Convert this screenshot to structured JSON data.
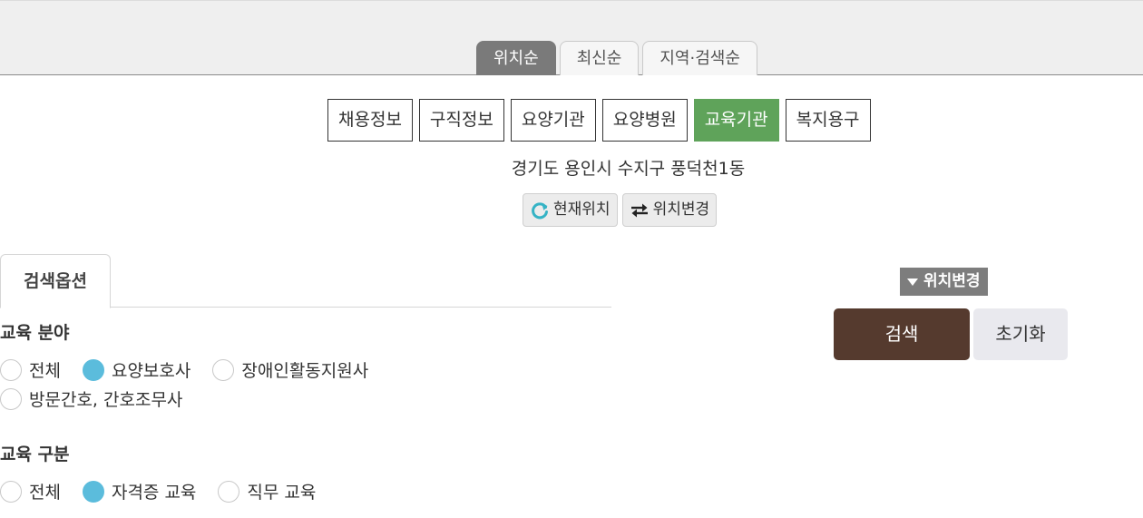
{
  "sort_tabs": [
    {
      "label": "위치순",
      "active": true
    },
    {
      "label": "최신순",
      "active": false
    },
    {
      "label": "지역·검색순",
      "active": false
    }
  ],
  "categories": [
    {
      "label": "채용정보",
      "active": false
    },
    {
      "label": "구직정보",
      "active": false
    },
    {
      "label": "요양기관",
      "active": false
    },
    {
      "label": "요양병원",
      "active": false
    },
    {
      "label": "교육기관",
      "active": true
    },
    {
      "label": "복지용구",
      "active": false
    }
  ],
  "location": {
    "address": "경기도 용인시 수지구 풍덕천1동",
    "current_label": "현재위치",
    "change_label": "위치변경"
  },
  "search_options": {
    "tab_label": "검색옵션",
    "field": {
      "title": "교육 분야",
      "options": [
        "전체",
        "요양보호사",
        "장애인활동지원사",
        "방문간호, 간호조무사"
      ],
      "selected": "요양보호사"
    },
    "type": {
      "title": "교육 구분",
      "options": [
        "전체",
        "자격증 교육",
        "직무 교육"
      ],
      "selected": "자격증 교육"
    }
  },
  "side": {
    "change_badge": "위치변경",
    "search_button": "검색",
    "reset_button": "초기화"
  },
  "colors": {
    "active_category": "#5fa35a",
    "radio_checked": "#5bbcdc",
    "search_button": "#553a2e",
    "active_sort_tab": "#7a7a7a"
  }
}
